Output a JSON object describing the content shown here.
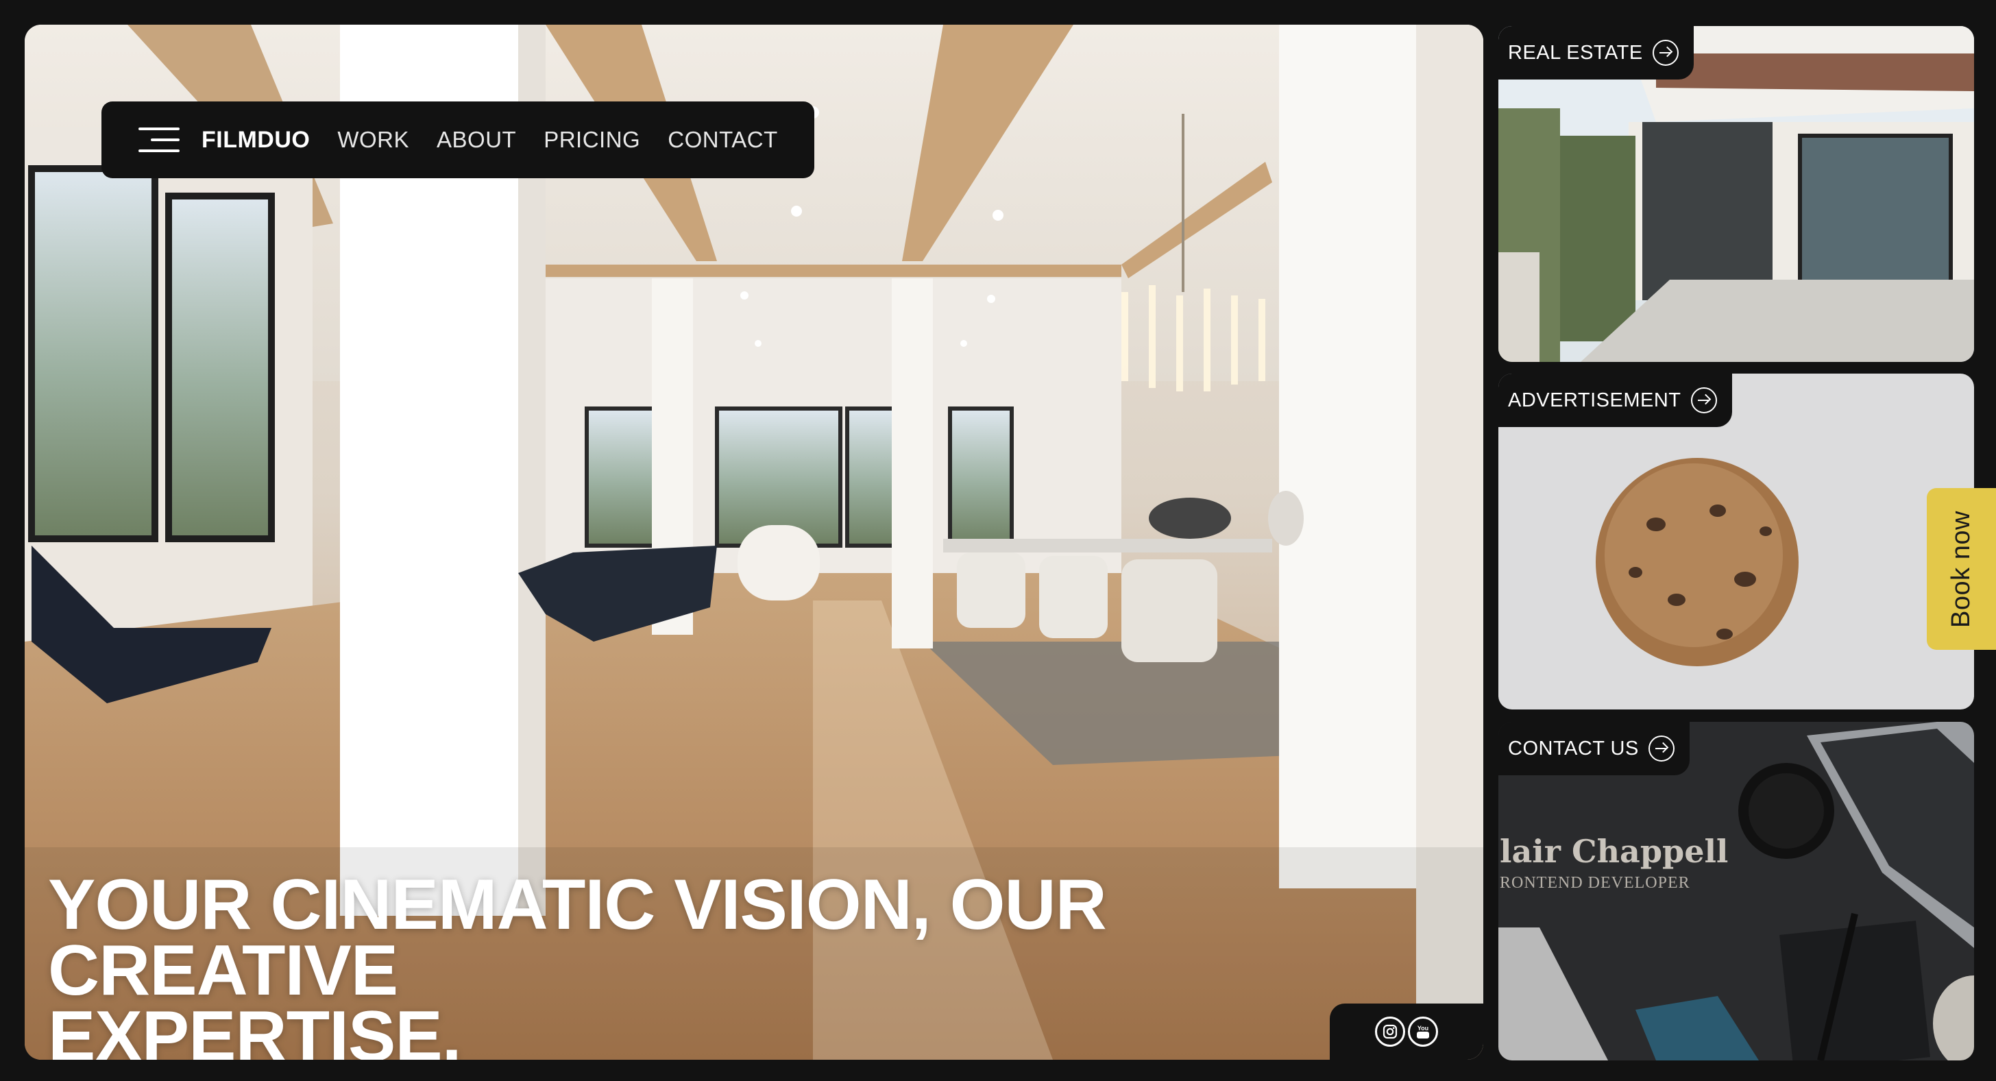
{
  "nav": {
    "brand": "FILMDUO",
    "links": [
      "WORK",
      "ABOUT",
      "PRICING",
      "CONTACT"
    ]
  },
  "hero": {
    "headline_line1": "YOUR CINEMATIC VISION, OUR CREATIVE",
    "headline_line2": "EXPERTISE."
  },
  "social": {
    "icons": [
      "instagram-icon",
      "youtube-icon"
    ],
    "youtube_text": "You"
  },
  "cards": [
    {
      "label": "REAL ESTATE",
      "icon": "arrow-right-circle-icon"
    },
    {
      "label": "ADVERTISEMENT",
      "icon": "arrow-right-circle-icon"
    },
    {
      "label": "CONTACT US",
      "icon": "arrow-right-circle-icon"
    }
  ],
  "contact_card": {
    "name": "lair Chappell",
    "role": "RONTEND DEVELOPER"
  },
  "book_now": "Book now",
  "colors": {
    "background": "#121212",
    "accent": "#e3c84a",
    "text": "#ffffff"
  }
}
